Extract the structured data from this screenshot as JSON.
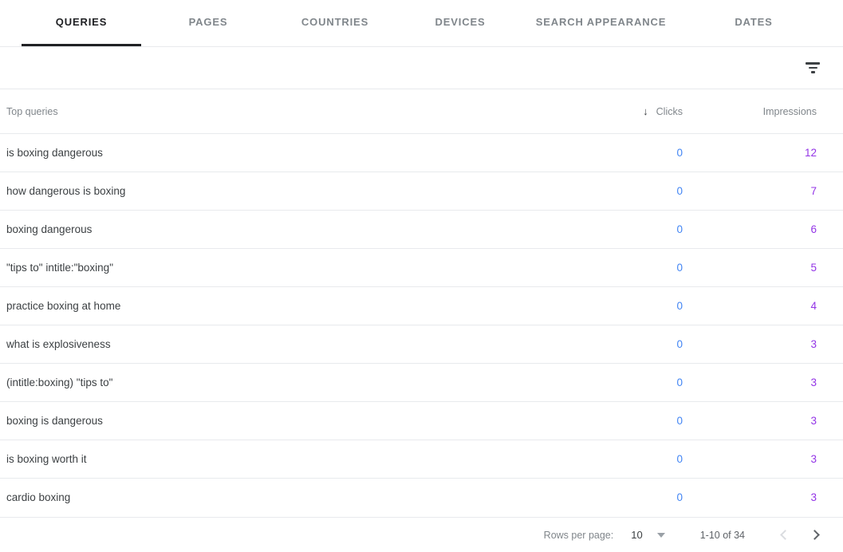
{
  "tabs": [
    {
      "label": "QUERIES",
      "active": true
    },
    {
      "label": "PAGES",
      "active": false
    },
    {
      "label": "COUNTRIES",
      "active": false
    },
    {
      "label": "DEVICES",
      "active": false
    },
    {
      "label": "SEARCH APPEARANCE",
      "active": false
    },
    {
      "label": "DATES",
      "active": false
    }
  ],
  "toolbar": {
    "filter_icon": "filter-icon"
  },
  "table": {
    "columns": {
      "query": "Top queries",
      "clicks": "Clicks",
      "impressions": "Impressions"
    },
    "sort": {
      "column": "Clicks",
      "direction": "desc",
      "arrow": "↓"
    },
    "rows": [
      {
        "query": "is boxing dangerous",
        "clicks": "0",
        "impressions": "12"
      },
      {
        "query": "how dangerous is boxing",
        "clicks": "0",
        "impressions": "7"
      },
      {
        "query": "boxing dangerous",
        "clicks": "0",
        "impressions": "6"
      },
      {
        "query": "\"tips to\" intitle:\"boxing\"",
        "clicks": "0",
        "impressions": "5"
      },
      {
        "query": "practice boxing at home",
        "clicks": "0",
        "impressions": "4"
      },
      {
        "query": "what is explosiveness",
        "clicks": "0",
        "impressions": "3"
      },
      {
        "query": "(intitle:boxing) \"tips to\"",
        "clicks": "0",
        "impressions": "3"
      },
      {
        "query": "boxing is dangerous",
        "clicks": "0",
        "impressions": "3"
      },
      {
        "query": "is boxing worth it",
        "clicks": "0",
        "impressions": "3"
      },
      {
        "query": "cardio boxing",
        "clicks": "0",
        "impressions": "3"
      }
    ]
  },
  "pagination": {
    "rows_per_page_label": "Rows per page:",
    "rows_per_page_value": "10",
    "range_label": "1-10 of 34",
    "prev_icon": "chevron-left-icon",
    "next_icon": "chevron-right-icon"
  },
  "colors": {
    "clicks": "#4285f4",
    "impressions": "#9334e6",
    "active_tab": "#202124",
    "inactive_tab": "#80868b",
    "divider": "#e8eaed"
  }
}
